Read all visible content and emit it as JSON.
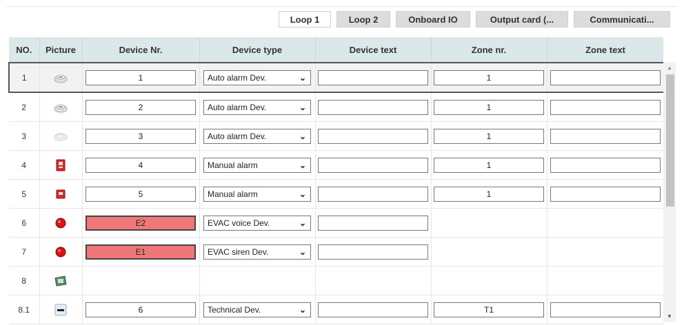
{
  "tabs": [
    "Loop 1",
    "Loop 2",
    "Onboard IO",
    "Output card (...",
    "Communicati..."
  ],
  "columns": [
    "NO.",
    "Picture",
    "Device Nr.",
    "Device type",
    "Device text",
    "Zone nr.",
    "Zone text"
  ],
  "rows": [
    {
      "no": "1",
      "pic": "smoke-detector-icon",
      "device_nr": "1",
      "device_type": "Auto alarm Dev.",
      "zone_nr": "1"
    },
    {
      "no": "2",
      "pic": "smoke-detector-icon",
      "device_nr": "2",
      "device_type": "Auto alarm Dev.",
      "zone_nr": "1"
    },
    {
      "no": "3",
      "pic": "heat-detector-icon",
      "device_nr": "3",
      "device_type": "Auto alarm Dev.",
      "zone_nr": "1"
    },
    {
      "no": "4",
      "pic": "manual-call-point-icon",
      "device_nr": "4",
      "device_type": "Manual alarm",
      "zone_nr": "1"
    },
    {
      "no": "5",
      "pic": "manual-call-point-small-icon",
      "device_nr": "5",
      "device_type": "Manual alarm",
      "zone_nr": "1"
    },
    {
      "no": "6",
      "pic": "evac-device-icon",
      "device_nr": "E2",
      "device_type": "EVAC voice Dev."
    },
    {
      "no": "7",
      "pic": "evac-device-icon",
      "device_nr": "E1",
      "device_type": "EVAC siren Dev."
    },
    {
      "no": "8",
      "pic": "module-card-icon"
    },
    {
      "no": "8.1",
      "pic": "technical-device-icon",
      "device_nr": "6",
      "device_type": "Technical Dev.",
      "zone_nr": "T1"
    }
  ],
  "colors": {
    "header_bg": "#dbe8ea",
    "error_cell": "#f07777",
    "tab_inactive": "#dcdcdc"
  }
}
